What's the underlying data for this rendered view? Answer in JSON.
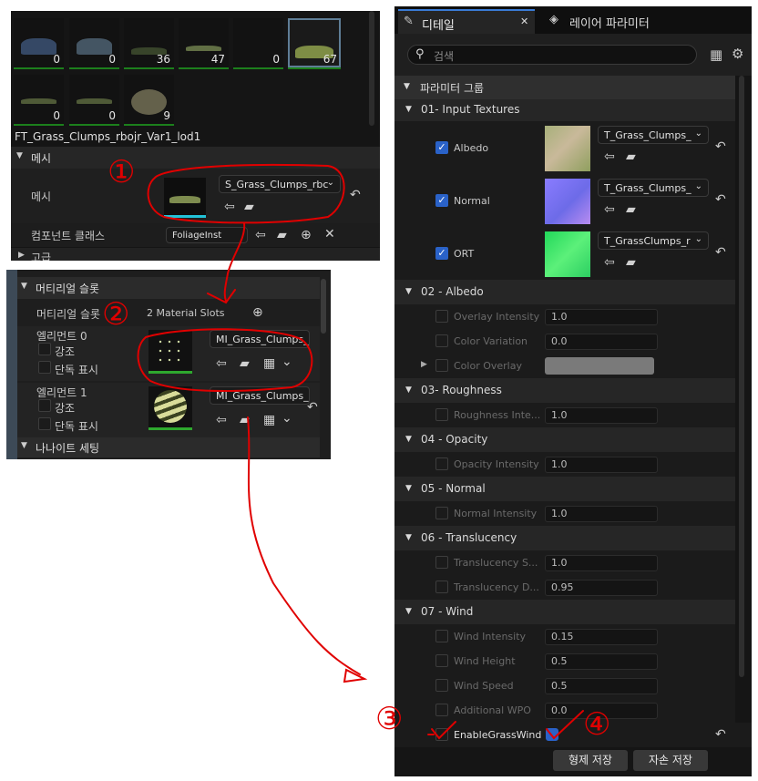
{
  "panel1": {
    "thumbnails": [
      {
        "count": "0"
      },
      {
        "count": "0"
      },
      {
        "count": "36"
      },
      {
        "count": "47"
      },
      {
        "count": "0"
      },
      {
        "count": "67"
      },
      {
        "count": "0"
      },
      {
        "count": "0"
      },
      {
        "count": "9"
      }
    ],
    "asset_name": "FT_Grass_Clumps_rbojr_Var1_lod1",
    "mesh_section": "메시",
    "mesh_label": "메시",
    "mesh_value": "S_Grass_Clumps_rbc",
    "component_class_label": "컴포넌트 클래스",
    "component_class_value": "FoliageInst",
    "advanced_label": "고급"
  },
  "panel2": {
    "section_title": "머티리얼 슬롯",
    "slots_label": "머티리얼 슬롯",
    "slots_value": "2 Material Slots",
    "element0_label": "엘리먼트 0",
    "element1_label": "엘리먼트 1",
    "highlight_label": "강조",
    "isolate_label": "단독 표시",
    "element0_value": "MI_Grass_Clumps_",
    "element1_value": "MI_Grass_Clumps_",
    "nanite_title": "나나이트 세팅"
  },
  "details": {
    "tab_details": "디테일",
    "tab_layers": "레이어 파라미터",
    "search_placeholder": "검색",
    "param_group": "파라미터 그룹",
    "g01": "01- Input Textures",
    "albedo": "Albedo",
    "albedo_tex": "T_Grass_Clumps_",
    "normal": "Normal",
    "normal_tex": "T_Grass_Clumps_",
    "ort": "ORT",
    "ort_tex": "T_GrassClumps_r",
    "g02": "02 - Albedo",
    "overlay_int": "Overlay Intensity",
    "overlay_int_val": "1.0",
    "color_var": "Color Variation",
    "color_var_val": "0.0",
    "color_overlay": "Color Overlay",
    "g03": "03- Roughness",
    "rough_int": "Roughness Inte...",
    "rough_int_val": "1.0",
    "g04": "04 - Opacity",
    "opacity_int": "Opacity Intensity",
    "opacity_int_val": "1.0",
    "g05": "05 - Normal",
    "normal_int": "Normal Intensity",
    "normal_int_val": "1.0",
    "g06": "06 - Translucency",
    "trans_s": "Translucency S...",
    "trans_s_val": "1.0",
    "trans_d": "Translucency D...",
    "trans_d_val": "0.95",
    "g07": "07 - Wind",
    "wind_int": "Wind Intensity",
    "wind_int_val": "0.15",
    "wind_h": "Wind Height",
    "wind_h_val": "0.5",
    "wind_s": "Wind Speed",
    "wind_s_val": "0.5",
    "add_wpo": "Additional WPO",
    "add_wpo_val": "0.0",
    "grass_wind": "EnableGrassWind",
    "save_sibling": "형제 저장",
    "save_child": "자손 저장"
  },
  "annotations": {
    "n1": "①",
    "n2": "②",
    "n3": "③",
    "n4": "④"
  },
  "colors": {
    "panel_bg": "#151515",
    "row_bg": "#242424",
    "header_bg": "#2f2f2f",
    "accent_blue": "#2a62c8",
    "annotation_red": "#e00000"
  }
}
